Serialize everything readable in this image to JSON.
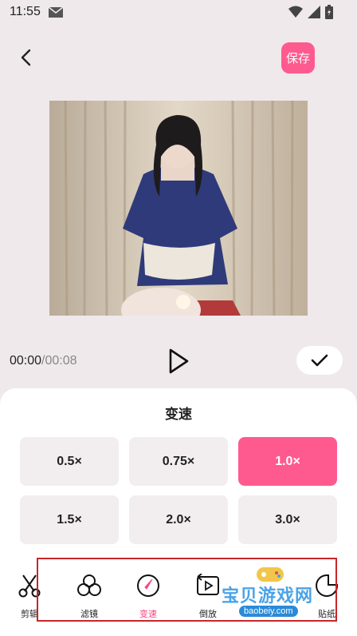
{
  "status": {
    "time": "11:55"
  },
  "header": {
    "save_label": "保存"
  },
  "player": {
    "current": "00:00",
    "separator": "/",
    "total": "00:08"
  },
  "panel": {
    "title": "变速",
    "speeds": [
      {
        "label": "0.5×",
        "active": false
      },
      {
        "label": "0.75×",
        "active": false
      },
      {
        "label": "1.0×",
        "active": true
      },
      {
        "label": "1.5×",
        "active": false
      },
      {
        "label": "2.0×",
        "active": false
      },
      {
        "label": "3.0×",
        "active": false
      }
    ]
  },
  "tools": [
    {
      "label": "剪辑",
      "icon": "scissors-icon"
    },
    {
      "label": "滤镜",
      "icon": "filter-icon"
    },
    {
      "label": "变速",
      "icon": "speed-icon",
      "active": true
    },
    {
      "label": "倒放",
      "icon": "reverse-icon"
    },
    {
      "label": "贴纸",
      "icon": "sticker-icon"
    }
  ],
  "watermark": {
    "text": "宝贝游戏网",
    "url": "baobeiy.com"
  },
  "colors": {
    "accent": "#ff5a8f",
    "background": "#efe9ec",
    "frame": "#c7262a"
  }
}
